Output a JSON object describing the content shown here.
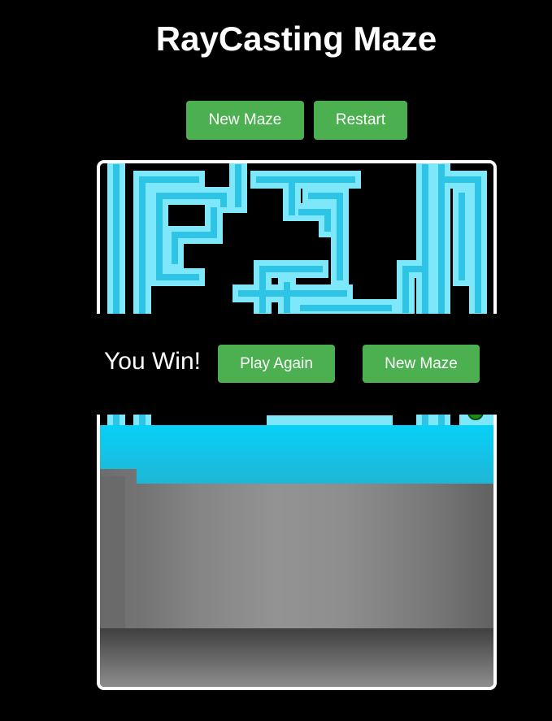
{
  "page": {
    "title": "RayCasting Maze"
  },
  "toolbar": {
    "new_maze_label": "New Maze",
    "restart_label": "Restart"
  },
  "overlay": {
    "message": "You Win!",
    "play_again_label": "Play Again",
    "new_maze_label": "New Maze"
  },
  "colors": {
    "background": "#000000",
    "button": "#4CAF50",
    "maze_wall": "#7ee8fa",
    "maze_wall_core": "#2ec4e6",
    "sky": "#08d0f8",
    "wall": "#939393",
    "floor": "#5a5a5a"
  },
  "icons": {
    "goal_marker": "green-circle-icon"
  }
}
